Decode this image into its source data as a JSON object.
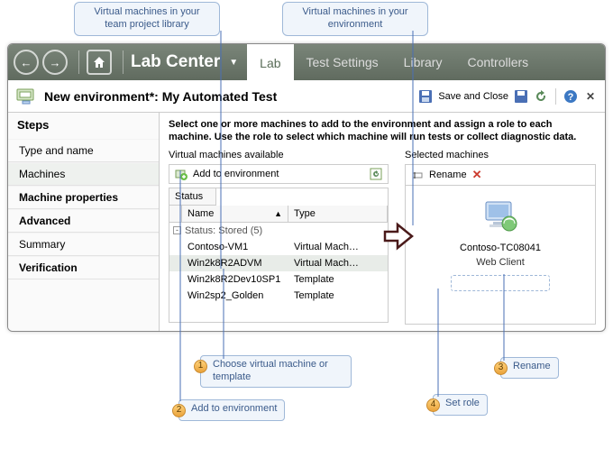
{
  "callouts": {
    "top_left": "Virtual machines in your team project library",
    "top_right": "Virtual machines in your environment"
  },
  "toolbar": {
    "app_title": "Lab Center",
    "tabs": {
      "lab": "Lab",
      "test_settings": "Test Settings",
      "library": "Library",
      "controllers": "Controllers"
    }
  },
  "subheader": {
    "title": "New environment*: My Automated Test",
    "save_close": "Save and Close"
  },
  "sidebar": {
    "heading": "Steps",
    "items": [
      "Type and name",
      "Machines",
      "Machine properties",
      "Advanced",
      "Summary",
      "Verification"
    ]
  },
  "main": {
    "instruction": "Select one or more machines to add to the environment and assign a role to each machine. Use the role to select which machine will run tests or collect diagnostic data.",
    "available": {
      "title": "Virtual machines available",
      "add_btn": "Add to environment",
      "filter_label": "Status",
      "col_name": "Name",
      "col_type": "Type",
      "group_label": "Status: Stored (5)",
      "rows": [
        {
          "name": "Contoso-VM1",
          "type": "Virtual Mach…"
        },
        {
          "name": "Win2k8R2ADVM",
          "type": "Virtual Mach…"
        },
        {
          "name": "Win2k8R2Dev10SP1",
          "type": "Template"
        },
        {
          "name": "Win2sp2_Golden",
          "type": "Template"
        }
      ]
    },
    "selected": {
      "title": "Selected machines",
      "rename_btn": "Rename",
      "machine_name": "Contoso-TC08041",
      "machine_role": "Web Client"
    }
  },
  "step_callouts": {
    "s1": "Choose virtual machine or template",
    "s2": "Add to environment",
    "s3": "Rename",
    "s4": "Set role"
  }
}
